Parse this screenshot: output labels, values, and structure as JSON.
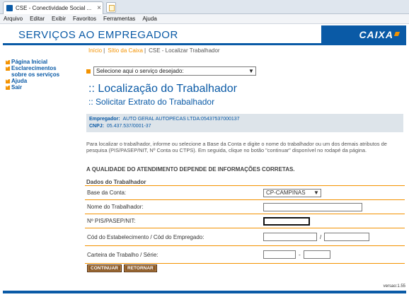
{
  "browser": {
    "tab_title": "CSE - Conectividade Social ...",
    "tab_close": "×",
    "menu": [
      "Arquivo",
      "Editar",
      "Exibir",
      "Favoritos",
      "Ferramentas",
      "Ajuda"
    ]
  },
  "header": {
    "title": "SERVIÇOS AO EMPREGADOR",
    "logo": "CAIXA",
    "brand_blue": "#0a5aa6",
    "accent_orange": "#f39200"
  },
  "breadcrumb": {
    "home": "Início",
    "site": "Sítio da Caixa",
    "current": "CSE - Localizar Trabalhador"
  },
  "sidebar": {
    "items": [
      {
        "label": "Página Inicial"
      },
      {
        "label": "Esclarecimentos sobre os serviços"
      },
      {
        "label": "Ajuda"
      },
      {
        "label": "Sair"
      }
    ]
  },
  "service_select": {
    "value": "Selecione aqui o serviço desejado:"
  },
  "page": {
    "title": ":: Localização do Trabalhador",
    "subtitle": ":: Solicitar Extrato do Trabalhador"
  },
  "employer": {
    "label": "Empregador:",
    "name": "AUTO GERAL AUTOPECAS LTDA:05437537000137",
    "cnpj_label": "CNPJ:",
    "cnpj": "05.437.537/0001-37"
  },
  "instructions": "Para localizar o trabalhador, informe ou selecione a Base da Conta e digite o nome do trabalhador ou um dos demais atributos de pesquisa (PIS/PASEP/NIT, Nº Conta ou CTPS). Em seguida, clique no botão \"continuar\" disponível no rodapé da página.",
  "quality_notice": "A QUALIDADE DO ATENDIMENTO DEPENDE DE INFORMAÇÕES CORRETAS.",
  "form": {
    "section": "Dados do Trabalhador",
    "base_label": "Base da Conta:",
    "base_value": "CP-CAMPINAS",
    "name_label": "Nome do Trabalhador:",
    "pis_label": "Nº PIS/PASEP/NIT:",
    "estab_label": "Cód do Estabelecimento / Cód do Empregado:",
    "estab_sep": "/",
    "ctps_label": "Carteira de Trabalho / Série:",
    "ctps_sep": "-"
  },
  "buttons": {
    "continue": "CONTINUAR",
    "back": "RETORNAR"
  },
  "version": "versao:1.55"
}
